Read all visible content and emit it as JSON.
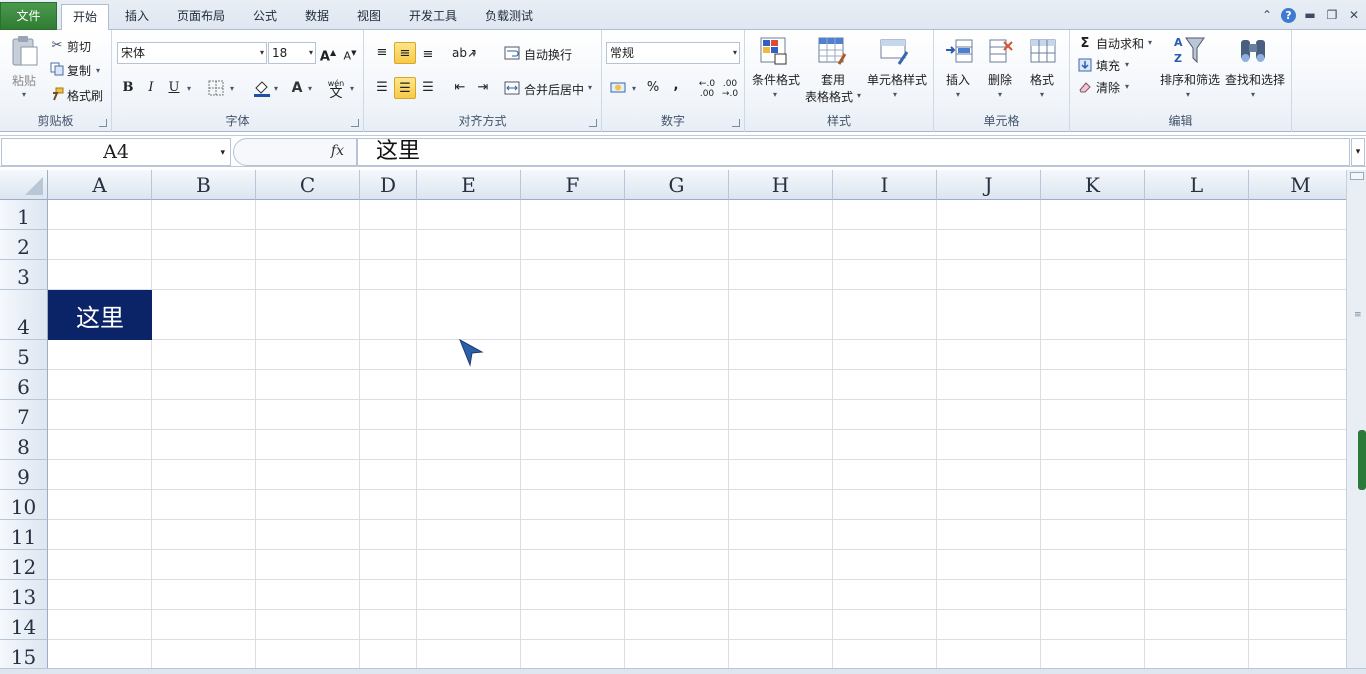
{
  "tabs": [
    "文件",
    "开始",
    "插入",
    "页面布局",
    "公式",
    "数据",
    "视图",
    "开发工具",
    "负载测试"
  ],
  "ribbon": {
    "clipboard": {
      "group": "剪贴板",
      "paste": "粘贴",
      "cut": "剪切",
      "copy": "复制",
      "format_painter": "格式刷"
    },
    "font": {
      "group": "字体",
      "font_name": "宋体",
      "font_size": "18",
      "bold": "B",
      "italic": "I",
      "underline": "U"
    },
    "alignment": {
      "group": "对齐方式",
      "wrap_text": "自动换行",
      "merge_center": "合并后居中"
    },
    "number": {
      "group": "数字",
      "format": "常规",
      "percent": "%",
      "comma": ","
    },
    "styles": {
      "group": "样式",
      "conditional": "条件格式",
      "table_1": "套用",
      "table_2": "表格格式",
      "cell_styles": "单元格样式"
    },
    "cells": {
      "group": "单元格",
      "insert": "插入",
      "delete": "删除",
      "format": "格式"
    },
    "editing": {
      "group": "编辑",
      "autosum": "自动求和",
      "fill": "填充",
      "clear": "清除",
      "sort_filter": "排序和筛选",
      "find_select": "查找和选择"
    }
  },
  "formula_bar": {
    "name_box": "A4",
    "fx": "fx",
    "content": "这里"
  },
  "columns": [
    "A",
    "B",
    "C",
    "D",
    "E",
    "F",
    "G",
    "H",
    "I",
    "J",
    "K",
    "L",
    "M"
  ],
  "rows": [
    "1",
    "2",
    "3",
    "4",
    "5",
    "6",
    "7",
    "8",
    "9",
    "10",
    "11",
    "12",
    "13",
    "14",
    "15"
  ],
  "cells": {
    "A4": "这里"
  },
  "colors": {
    "selected_cell_bg": "#0b2468",
    "file_tab": "#3c8c40"
  }
}
